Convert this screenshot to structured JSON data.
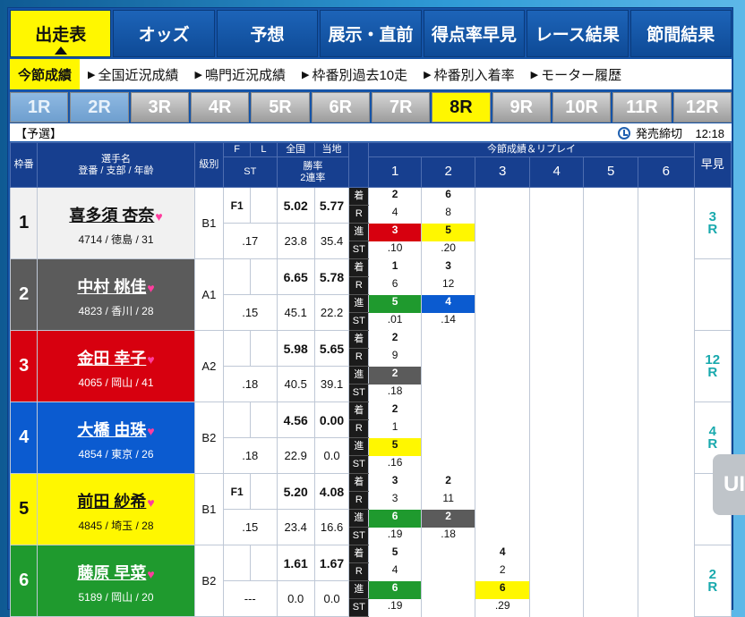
{
  "tabs": [
    "出走表",
    "オッズ",
    "予想",
    "展示・直前",
    "得点率早見",
    "レース結果",
    "節間結果"
  ],
  "subnav": [
    "今節成績",
    "全国近況成績",
    "鳴門近況成績",
    "枠番別過去10走",
    "枠番別入着率",
    "モーター履歴"
  ],
  "races": [
    "1R",
    "2R",
    "3R",
    "4R",
    "5R",
    "6R",
    "7R",
    "8R",
    "9R",
    "10R",
    "11R",
    "12R"
  ],
  "race_info": {
    "type": "【予選】",
    "deadline_label": "発売締切",
    "deadline_time": "12:18"
  },
  "headers": {
    "waku": "枠番",
    "player": "選手名",
    "player_sub": "登番 / 支部 / 年齢",
    "class": "級別",
    "f": "F",
    "l": "L",
    "st": "ST",
    "national": "全国",
    "local": "当地",
    "rate": "勝率",
    "rate2": "2連率",
    "series": "今節成績＆リプレイ",
    "days": [
      "1",
      "2",
      "3",
      "4",
      "5",
      "6"
    ],
    "early": "早見"
  },
  "row_labels": [
    "着",
    "R",
    "進",
    "ST"
  ],
  "racers": [
    {
      "waku": "1",
      "name": "喜多須 杏奈",
      "meta": "4714 / 徳島 / 31",
      "class": "B1",
      "f": "F1",
      "st": ".17",
      "nat_win": "5.02",
      "nat_2": "23.8",
      "loc_win": "5.77",
      "loc_2": "35.4",
      "res": [
        [
          "2",
          "4",
          "3",
          ".10"
        ],
        [
          "6",
          "8",
          "5",
          ".20"
        ]
      ],
      "cols": [
        "cR",
        "cY"
      ],
      "early": "3R"
    },
    {
      "waku": "2",
      "name": "中村 桃佳",
      "meta": "4823 / 香川 / 28",
      "class": "A1",
      "f": "",
      "st": ".15",
      "nat_win": "6.65",
      "nat_2": "45.1",
      "loc_win": "5.78",
      "loc_2": "22.2",
      "res": [
        [
          "1",
          "6",
          "5",
          ".01"
        ],
        [
          "3",
          "12",
          "4",
          ".14"
        ]
      ],
      "cols": [
        "cG",
        "cB"
      ],
      "early": ""
    },
    {
      "waku": "3",
      "name": "金田 幸子",
      "meta": "4065 / 岡山 / 41",
      "class": "A2",
      "f": "",
      "st": ".18",
      "nat_win": "5.98",
      "nat_2": "40.5",
      "loc_win": "5.65",
      "loc_2": "39.1",
      "res": [
        [
          "2",
          "9",
          "2",
          ".18"
        ]
      ],
      "cols": [
        "cK"
      ],
      "early": "12R"
    },
    {
      "waku": "4",
      "name": "大橋 由珠",
      "meta": "4854 / 東京 / 26",
      "class": "B2",
      "f": "",
      "st": ".18",
      "nat_win": "4.56",
      "nat_2": "22.9",
      "loc_win": "0.00",
      "loc_2": "0.0",
      "res": [
        [
          "2",
          "1",
          "5",
          ".16"
        ]
      ],
      "cols": [
        "cY"
      ],
      "early": "4R"
    },
    {
      "waku": "5",
      "name": "前田 紗希",
      "meta": "4845 / 埼玉 / 28",
      "class": "B1",
      "f": "F1",
      "st": ".15",
      "nat_win": "5.20",
      "nat_2": "23.4",
      "loc_win": "4.08",
      "loc_2": "16.6",
      "res": [
        [
          "3",
          "3",
          "6",
          ".19"
        ],
        [
          "2",
          "11",
          "2",
          ".18"
        ]
      ],
      "cols": [
        "cG",
        "cK"
      ],
      "early": ""
    },
    {
      "waku": "6",
      "name": "藤原 早菜",
      "meta": "5189 / 岡山 / 20",
      "class": "B2",
      "f": "",
      "st": "---",
      "nat_win": "1.61",
      "nat_2": "0.0",
      "loc_win": "1.67",
      "loc_2": "0.0",
      "res": [
        [
          "5",
          "4",
          "6",
          ".19"
        ],
        [
          "",
          "",
          "",
          ""
        ],
        [
          "4",
          "2",
          "6",
          ".29"
        ]
      ],
      "cols": [
        "cG",
        "",
        "cY"
      ],
      "early": "2R"
    }
  ],
  "side_chip": "UI"
}
